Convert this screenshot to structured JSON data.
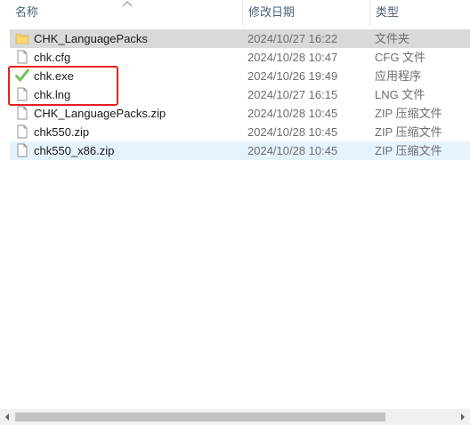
{
  "columns": {
    "name": "名称",
    "date": "修改日期",
    "type": "类型"
  },
  "files": [
    {
      "name": "CHK_LanguagePacks",
      "date": "2024/10/27 16:22",
      "type": "文件夹",
      "icon": "folder-icon"
    },
    {
      "name": "chk.cfg",
      "date": "2024/10/28 10:47",
      "type": "CFG 文件",
      "icon": "file-icon"
    },
    {
      "name": "chk.exe",
      "date": "2024/10/26 19:49",
      "type": "应用程序",
      "icon": "checkmark-app-icon"
    },
    {
      "name": "chk.lng",
      "date": "2024/10/27 16:15",
      "type": "LNG 文件",
      "icon": "file-icon"
    },
    {
      "name": "CHK_LanguagePacks.zip",
      "date": "2024/10/28 10:45",
      "type": "ZIP 压缩文件",
      "icon": "file-icon"
    },
    {
      "name": "chk550.zip",
      "date": "2024/10/28 10:45",
      "type": "ZIP 压缩文件",
      "icon": "file-icon"
    },
    {
      "name": "chk550_x86.zip",
      "date": "2024/10/28 10:45",
      "type": "ZIP 压缩文件",
      "icon": "file-icon"
    }
  ],
  "colors": {
    "highlight": "#e8201f",
    "selected_row": "#d9d9d9",
    "hover_row": "#e5f3ff",
    "folder": "#f8d775",
    "check": "#4caf32"
  }
}
